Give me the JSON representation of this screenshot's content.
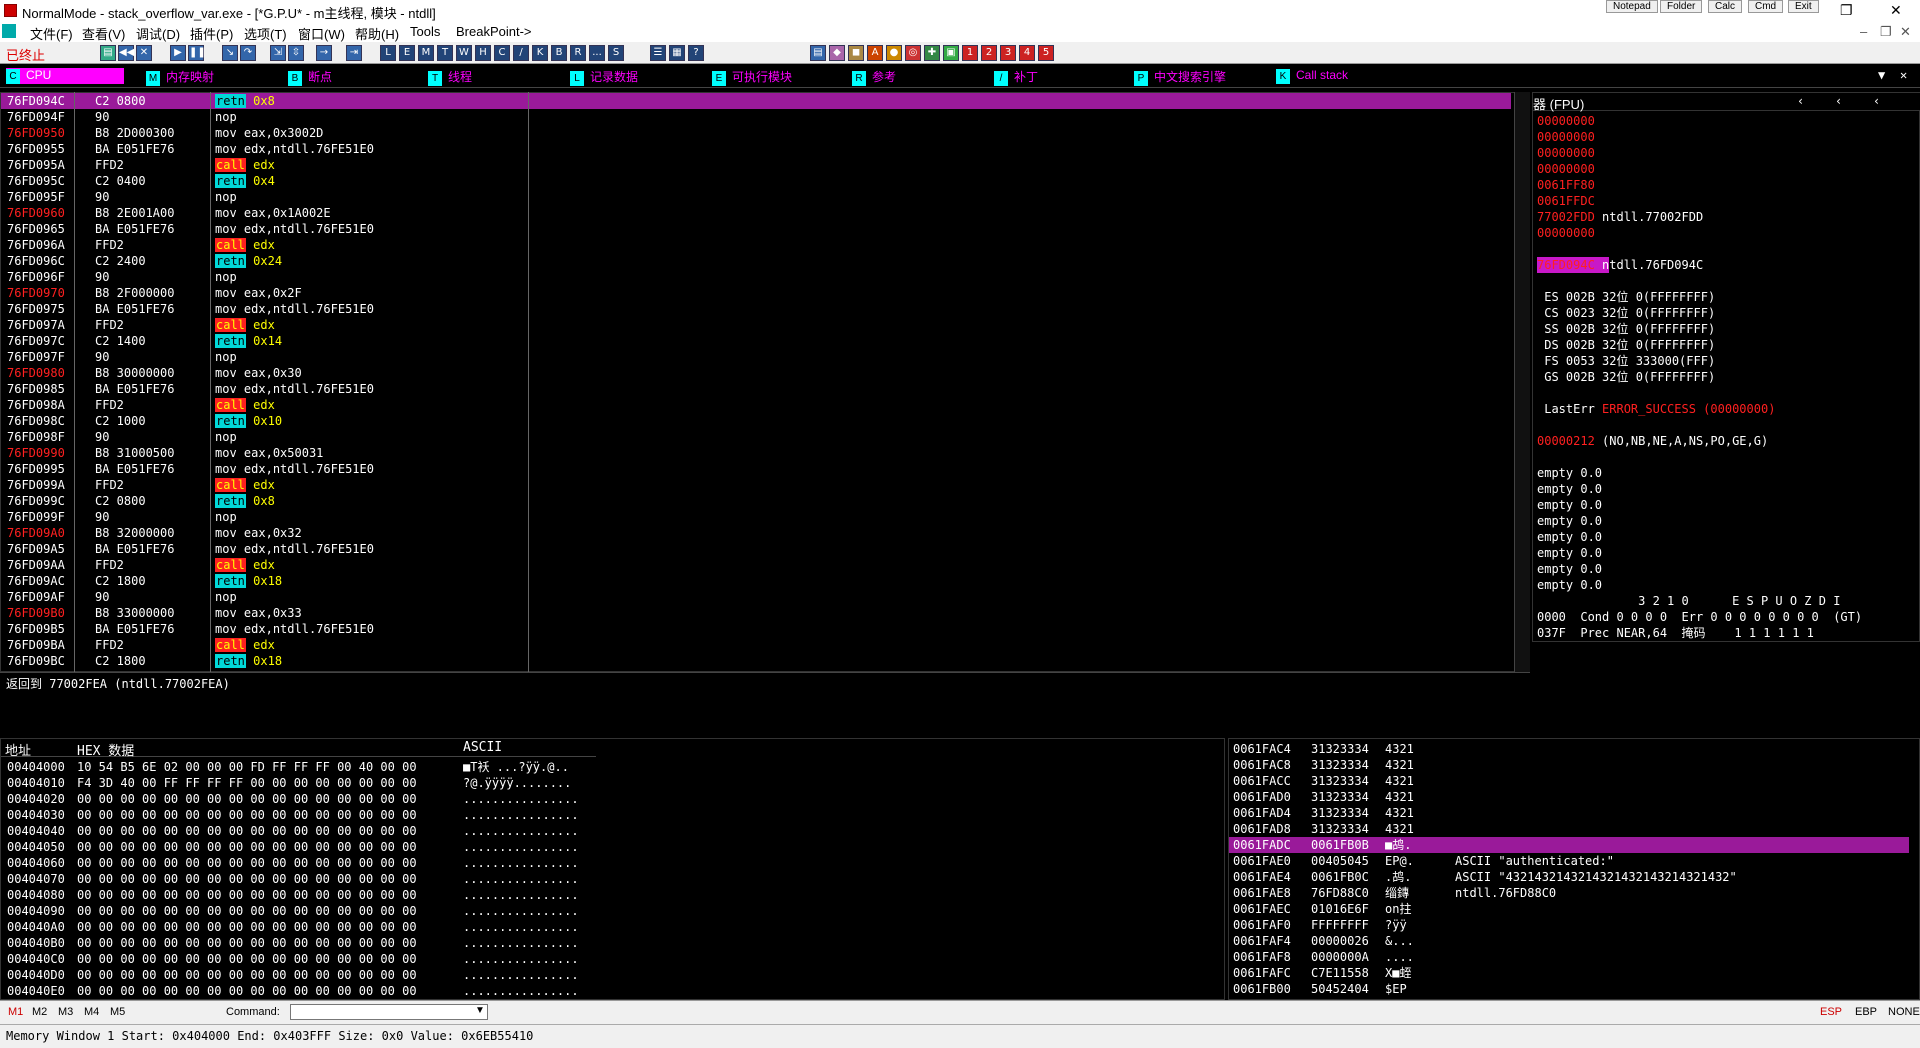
{
  "window": {
    "title": "NormalMode - stack_overflow_var.exe - [*G.P.U* - m主线程, 模块 - ntdll]",
    "top_buttons": [
      "Notepad",
      "Folder",
      "Calc",
      "Cmd",
      "Exit"
    ]
  },
  "menu": [
    "文件(F)",
    "查看(V)",
    "调试(D)",
    "插件(P)",
    "选项(T)",
    "窗口(W)",
    "帮助(H)",
    "Tools",
    "BreakPoint->"
  ],
  "toolbar": {
    "status": "已终止",
    "letters": [
      "L",
      "E",
      "M",
      "T",
      "W",
      "H",
      "C",
      "/",
      "K",
      "B",
      "R",
      "...",
      "S"
    ]
  },
  "window_tabs": [
    {
      "key": "C",
      "label": "CPU",
      "active": true
    },
    {
      "key": "M",
      "label": "内存映射"
    },
    {
      "key": "B",
      "label": "断点"
    },
    {
      "key": "T",
      "label": "线程"
    },
    {
      "key": "L",
      "label": "记录数据"
    },
    {
      "key": "E",
      "label": "可执行模块"
    },
    {
      "key": "R",
      "label": "参考"
    },
    {
      "key": "/",
      "label": "补丁"
    },
    {
      "key": "P",
      "label": "中文搜索引擎"
    },
    {
      "key": "K",
      "label": "Call stack"
    }
  ],
  "disasm": [
    {
      "addr": "76FD094C",
      "hex": "C2 0800",
      "op": "retn",
      "arg": "0x8",
      "kind": "ret",
      "sel": true
    },
    {
      "addr": "76FD094F",
      "hex": "90",
      "op": "nop",
      "arg": "",
      "kind": "nop"
    },
    {
      "addr": "76FD0950",
      "hex": "B8 2D000300",
      "op": "mov",
      "arg": "eax,0x3002D",
      "kind": "mov",
      "red": true
    },
    {
      "addr": "76FD0955",
      "hex": "BA E051FE76",
      "op": "mov",
      "arg": "edx,ntdll.76FE51E0",
      "kind": "mov"
    },
    {
      "addr": "76FD095A",
      "hex": "FFD2",
      "op": "call",
      "arg": "edx",
      "kind": "call"
    },
    {
      "addr": "76FD095C",
      "hex": "C2 0400",
      "op": "retn",
      "arg": "0x4",
      "kind": "ret"
    },
    {
      "addr": "76FD095F",
      "hex": "90",
      "op": "nop",
      "arg": "",
      "kind": "nop"
    },
    {
      "addr": "76FD0960",
      "hex": "B8 2E001A00",
      "op": "mov",
      "arg": "eax,0x1A002E",
      "kind": "mov",
      "red": true
    },
    {
      "addr": "76FD0965",
      "hex": "BA E051FE76",
      "op": "mov",
      "arg": "edx,ntdll.76FE51E0",
      "kind": "mov"
    },
    {
      "addr": "76FD096A",
      "hex": "FFD2",
      "op": "call",
      "arg": "edx",
      "kind": "call"
    },
    {
      "addr": "76FD096C",
      "hex": "C2 2400",
      "op": "retn",
      "arg": "0x24",
      "kind": "ret"
    },
    {
      "addr": "76FD096F",
      "hex": "90",
      "op": "nop",
      "arg": "",
      "kind": "nop"
    },
    {
      "addr": "76FD0970",
      "hex": "B8 2F000000",
      "op": "mov",
      "arg": "eax,0x2F",
      "kind": "mov",
      "red": true
    },
    {
      "addr": "76FD0975",
      "hex": "BA E051FE76",
      "op": "mov",
      "arg": "edx,ntdll.76FE51E0",
      "kind": "mov"
    },
    {
      "addr": "76FD097A",
      "hex": "FFD2",
      "op": "call",
      "arg": "edx",
      "kind": "call"
    },
    {
      "addr": "76FD097C",
      "hex": "C2 1400",
      "op": "retn",
      "arg": "0x14",
      "kind": "ret"
    },
    {
      "addr": "76FD097F",
      "hex": "90",
      "op": "nop",
      "arg": "",
      "kind": "nop"
    },
    {
      "addr": "76FD0980",
      "hex": "B8 30000000",
      "op": "mov",
      "arg": "eax,0x30",
      "kind": "mov",
      "red": true
    },
    {
      "addr": "76FD0985",
      "hex": "BA E051FE76",
      "op": "mov",
      "arg": "edx,ntdll.76FE51E0",
      "kind": "mov"
    },
    {
      "addr": "76FD098A",
      "hex": "FFD2",
      "op": "call",
      "arg": "edx",
      "kind": "call"
    },
    {
      "addr": "76FD098C",
      "hex": "C2 1000",
      "op": "retn",
      "arg": "0x10",
      "kind": "ret"
    },
    {
      "addr": "76FD098F",
      "hex": "90",
      "op": "nop",
      "arg": "",
      "kind": "nop"
    },
    {
      "addr": "76FD0990",
      "hex": "B8 31000500",
      "op": "mov",
      "arg": "eax,0x50031",
      "kind": "mov",
      "red": true
    },
    {
      "addr": "76FD0995",
      "hex": "BA E051FE76",
      "op": "mov",
      "arg": "edx,ntdll.76FE51E0",
      "kind": "mov"
    },
    {
      "addr": "76FD099A",
      "hex": "FFD2",
      "op": "call",
      "arg": "edx",
      "kind": "call"
    },
    {
      "addr": "76FD099C",
      "hex": "C2 0800",
      "op": "retn",
      "arg": "0x8",
      "kind": "ret"
    },
    {
      "addr": "76FD099F",
      "hex": "90",
      "op": "nop",
      "arg": "",
      "kind": "nop"
    },
    {
      "addr": "76FD09A0",
      "hex": "B8 32000000",
      "op": "mov",
      "arg": "eax,0x32",
      "kind": "mov",
      "red": true
    },
    {
      "addr": "76FD09A5",
      "hex": "BA E051FE76",
      "op": "mov",
      "arg": "edx,ntdll.76FE51E0",
      "kind": "mov"
    },
    {
      "addr": "76FD09AA",
      "hex": "FFD2",
      "op": "call",
      "arg": "edx",
      "kind": "call"
    },
    {
      "addr": "76FD09AC",
      "hex": "C2 1800",
      "op": "retn",
      "arg": "0x18",
      "kind": "ret"
    },
    {
      "addr": "76FD09AF",
      "hex": "90",
      "op": "nop",
      "arg": "",
      "kind": "nop"
    },
    {
      "addr": "76FD09B0",
      "hex": "B8 33000000",
      "op": "mov",
      "arg": "eax,0x33",
      "kind": "mov",
      "red": true
    },
    {
      "addr": "76FD09B5",
      "hex": "BA E051FE76",
      "op": "mov",
      "arg": "edx,ntdll.76FE51E0",
      "kind": "mov"
    },
    {
      "addr": "76FD09BA",
      "hex": "FFD2",
      "op": "call",
      "arg": "edx",
      "kind": "call"
    },
    {
      "addr": "76FD09BC",
      "hex": "C2 1800",
      "op": "retn",
      "arg": "0x18",
      "kind": "ret"
    }
  ],
  "info": "返回到 77002FEA (ntdll.77002FEA)",
  "registers": {
    "header": "器 (FPU)",
    "lines": [
      {
        "t": "00000000",
        "c": "red"
      },
      {
        "t": "00000000",
        "c": "red"
      },
      {
        "t": "00000000",
        "c": "red"
      },
      {
        "t": "00000000",
        "c": "red"
      },
      {
        "t": "0061FF80",
        "c": "red"
      },
      {
        "t": "0061FFDC",
        "c": "red"
      },
      {
        "t": "77002FDD ntdll.77002FDD",
        "c": "mixed"
      },
      {
        "t": "00000000",
        "c": "red"
      },
      {
        "t": "",
        "c": ""
      },
      {
        "t": "76FD094C ntdll.76FD094C",
        "c": "eip"
      },
      {
        "t": "",
        "c": ""
      },
      {
        "t": " ES 002B 32位 0(FFFFFFFF)",
        "c": ""
      },
      {
        "t": " CS 0023 32位 0(FFFFFFFF)",
        "c": ""
      },
      {
        "t": " SS 002B 32位 0(FFFFFFFF)",
        "c": ""
      },
      {
        "t": " DS 002B 32位 0(FFFFFFFF)",
        "c": ""
      },
      {
        "t": " FS 0053 32位 333000(FFF)",
        "c": ""
      },
      {
        "t": " GS 002B 32位 0(FFFFFFFF)",
        "c": ""
      },
      {
        "t": "",
        "c": ""
      },
      {
        "t": " LastErr ERROR_SUCCESS (00000000)",
        "c": "lasterr"
      },
      {
        "t": "",
        "c": ""
      },
      {
        "t": "00000212 (NO,NB,NE,A,NS,PO,GE,G)",
        "c": "efl"
      },
      {
        "t": "",
        "c": ""
      },
      {
        "t": "empty 0.0",
        "c": ""
      },
      {
        "t": "empty 0.0",
        "c": ""
      },
      {
        "t": "empty 0.0",
        "c": ""
      },
      {
        "t": "empty 0.0",
        "c": ""
      },
      {
        "t": "empty 0.0",
        "c": ""
      },
      {
        "t": "empty 0.0",
        "c": ""
      },
      {
        "t": "empty 0.0",
        "c": ""
      },
      {
        "t": "empty 0.0",
        "c": ""
      },
      {
        "t": "              3 2 1 0      E S P U O Z D I",
        "c": ""
      },
      {
        "t": "0000  Cond 0 0 0 0  Err 0 0 0 0 0 0 0 0  (GT)",
        "c": ""
      },
      {
        "t": "037F  Prec NEAR,64  掩码    1 1 1 1 1 1",
        "c": ""
      }
    ]
  },
  "dump": {
    "headers": {
      "addr": "地址",
      "hex": "HEX 数据",
      "ascii": "ASCII"
    },
    "rows": [
      {
        "a": "00404000",
        "h": "10 54 B5 6E 02 00 00 00 FD FF FF FF 00 40 00 00",
        "s": "■T袄 ...?ÿÿ.@.."
      },
      {
        "a": "00404010",
        "h": "F4 3D 40 00 FF FF FF FF 00 00 00 00 00 00 00 00",
        "s": "?@.ÿÿÿÿ........"
      },
      {
        "a": "00404020",
        "h": "00 00 00 00 00 00 00 00 00 00 00 00 00 00 00 00",
        "s": "................"
      },
      {
        "a": "00404030",
        "h": "00 00 00 00 00 00 00 00 00 00 00 00 00 00 00 00",
        "s": "................"
      },
      {
        "a": "00404040",
        "h": "00 00 00 00 00 00 00 00 00 00 00 00 00 00 00 00",
        "s": "................"
      },
      {
        "a": "00404050",
        "h": "00 00 00 00 00 00 00 00 00 00 00 00 00 00 00 00",
        "s": "................"
      },
      {
        "a": "00404060",
        "h": "00 00 00 00 00 00 00 00 00 00 00 00 00 00 00 00",
        "s": "................"
      },
      {
        "a": "00404070",
        "h": "00 00 00 00 00 00 00 00 00 00 00 00 00 00 00 00",
        "s": "................"
      },
      {
        "a": "00404080",
        "h": "00 00 00 00 00 00 00 00 00 00 00 00 00 00 00 00",
        "s": "................"
      },
      {
        "a": "00404090",
        "h": "00 00 00 00 00 00 00 00 00 00 00 00 00 00 00 00",
        "s": "................"
      },
      {
        "a": "004040A0",
        "h": "00 00 00 00 00 00 00 00 00 00 00 00 00 00 00 00",
        "s": "................"
      },
      {
        "a": "004040B0",
        "h": "00 00 00 00 00 00 00 00 00 00 00 00 00 00 00 00",
        "s": "................"
      },
      {
        "a": "004040C0",
        "h": "00 00 00 00 00 00 00 00 00 00 00 00 00 00 00 00",
        "s": "................"
      },
      {
        "a": "004040D0",
        "h": "00 00 00 00 00 00 00 00 00 00 00 00 00 00 00 00",
        "s": "................"
      },
      {
        "a": "004040E0",
        "h": "00 00 00 00 00 00 00 00 00 00 00 00 00 00 00 00",
        "s": "................"
      }
    ]
  },
  "stack": [
    {
      "a": "0061FAC4",
      "v": "31323334",
      "s": "4321",
      "c": ""
    },
    {
      "a": "0061FAC8",
      "v": "31323334",
      "s": "4321",
      "c": ""
    },
    {
      "a": "0061FACC",
      "v": "31323334",
      "s": "4321",
      "c": ""
    },
    {
      "a": "0061FAD0",
      "v": "31323334",
      "s": "4321",
      "c": ""
    },
    {
      "a": "0061FAD4",
      "v": "31323334",
      "s": "4321",
      "c": ""
    },
    {
      "a": "0061FAD8",
      "v": "31323334",
      "s": "4321",
      "c": ""
    },
    {
      "a": "0061FADC",
      "v": "0061FB0B",
      "s": "■鸪.",
      "c": "",
      "sel": true
    },
    {
      "a": "0061FAE0",
      "v": "00405045",
      "s": "EP@.",
      "c": "ASCII \"authenticated:\""
    },
    {
      "a": "0061FAE4",
      "v": "0061FB0C",
      "s": ".鸪.",
      "c": "ASCII \"4321432143214321432143214321432\""
    },
    {
      "a": "0061FAE8",
      "v": "76FD88C0",
      "s": "缁鏄",
      "c": "ntdll.76FD88C0"
    },
    {
      "a": "0061FAEC",
      "v": "01016E6F",
      "s": "on拄",
      "c": ""
    },
    {
      "a": "0061FAF0",
      "v": "FFFFFFFF",
      "s": "?ÿÿ",
      "c": ""
    },
    {
      "a": "0061FAF4",
      "v": "00000026",
      "s": "&...",
      "c": ""
    },
    {
      "a": "0061FAF8",
      "v": "0000000A",
      "s": "....",
      "c": ""
    },
    {
      "a": "0061FAFC",
      "v": "C7E11558",
      "s": "X■蛭",
      "c": ""
    },
    {
      "a": "0061FB00",
      "v": "50452404",
      "s": "$EP",
      "c": ""
    }
  ],
  "bottombar": {
    "mem_tabs": [
      "M1",
      "M2",
      "M3",
      "M4",
      "M5"
    ],
    "command_label": "Command:",
    "command_value": "",
    "right": [
      "ESP",
      "EBP",
      "NONE"
    ]
  },
  "statusbar": "Memory Window 1  Start: 0x404000  End: 0x403FFF  Size: 0x0 Value: 0x6EB55410"
}
